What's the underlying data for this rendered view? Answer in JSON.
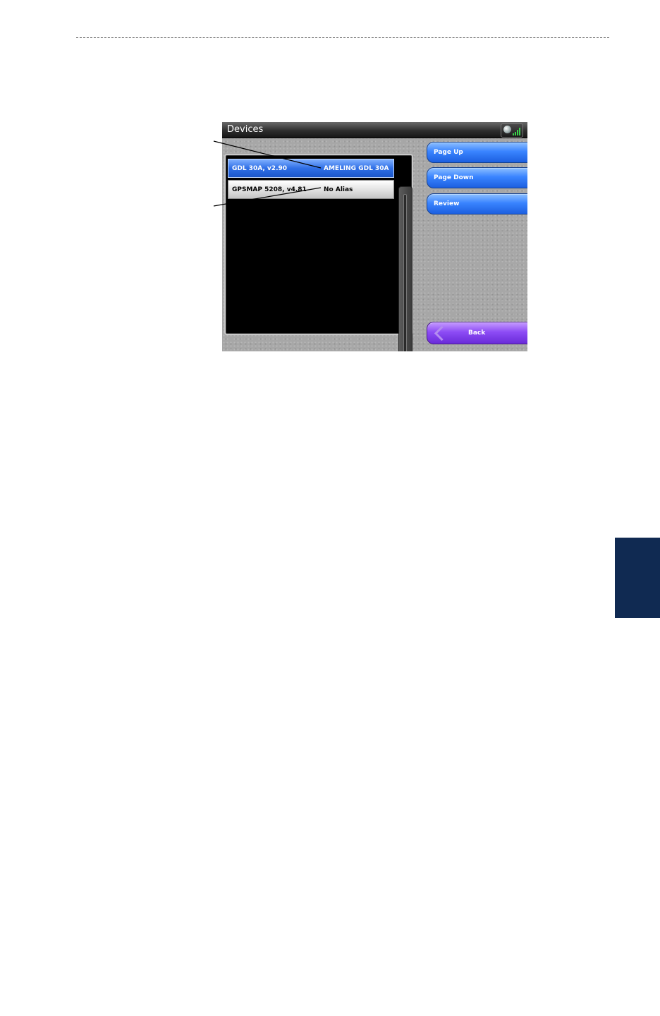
{
  "screen": {
    "title": "Devices",
    "devices": [
      {
        "name": "GDL 30A, v2.90",
        "alias": "AMELING GDL 30A"
      },
      {
        "name": "GPSMAP 5208, v4.81",
        "alias": "No Alias"
      }
    ],
    "buttons": {
      "page_up": "Page Up",
      "page_down": "Page Down",
      "review": "Review",
      "back": "Back"
    }
  },
  "colors": {
    "selected_row": "#2f6fe6",
    "nav_button": "#3a84ff",
    "back_button": "#8d4cf5",
    "side_tab": "#102a52"
  },
  "icons": [
    "signal-strength-icon",
    "back-arrow-icon"
  ]
}
